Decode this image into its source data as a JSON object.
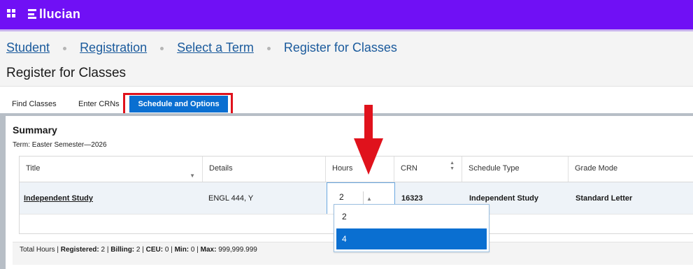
{
  "app": {
    "logo_text": "llucian"
  },
  "breadcrumb": {
    "items": [
      "Student",
      "Registration",
      "Select a Term"
    ],
    "current": "Register for Classes"
  },
  "page_title": "Register for Classes",
  "tabs": {
    "find_classes": "Find Classes",
    "enter_crns": "Enter CRNs",
    "schedule_options": "Schedule and Options"
  },
  "summary": {
    "title": "Summary",
    "term_label": "Term:",
    "term_value": "Easter Semester—2026"
  },
  "table": {
    "columns": [
      "Title",
      "Details",
      "Hours",
      "CRN",
      "Schedule Type",
      "Grade Mode"
    ],
    "rows": [
      {
        "title": "Independent Study",
        "details": "ENGL 444, Y",
        "hours": "2",
        "crn": "16323",
        "schedule_type": "Independent Study",
        "grade_mode": "Standard Letter"
      }
    ]
  },
  "hours_dropdown": {
    "options": [
      "2",
      "4"
    ],
    "highlighted": "4"
  },
  "footer": {
    "prefix": "Total Hours | ",
    "registered_label": "Registered:",
    "registered_value": " 2 | ",
    "billing_label": "Billing:",
    "billing_value": " 2 | ",
    "ceu_label": "CEU:",
    "ceu_value": " 0 | ",
    "min_label": "Min:",
    "min_value": " 0 | ",
    "max_label": "Max:",
    "max_value": " 999,999.999"
  },
  "colors": {
    "brand": "#7010f5",
    "accent": "#0a6fd1",
    "highlight": "#e0121c"
  }
}
